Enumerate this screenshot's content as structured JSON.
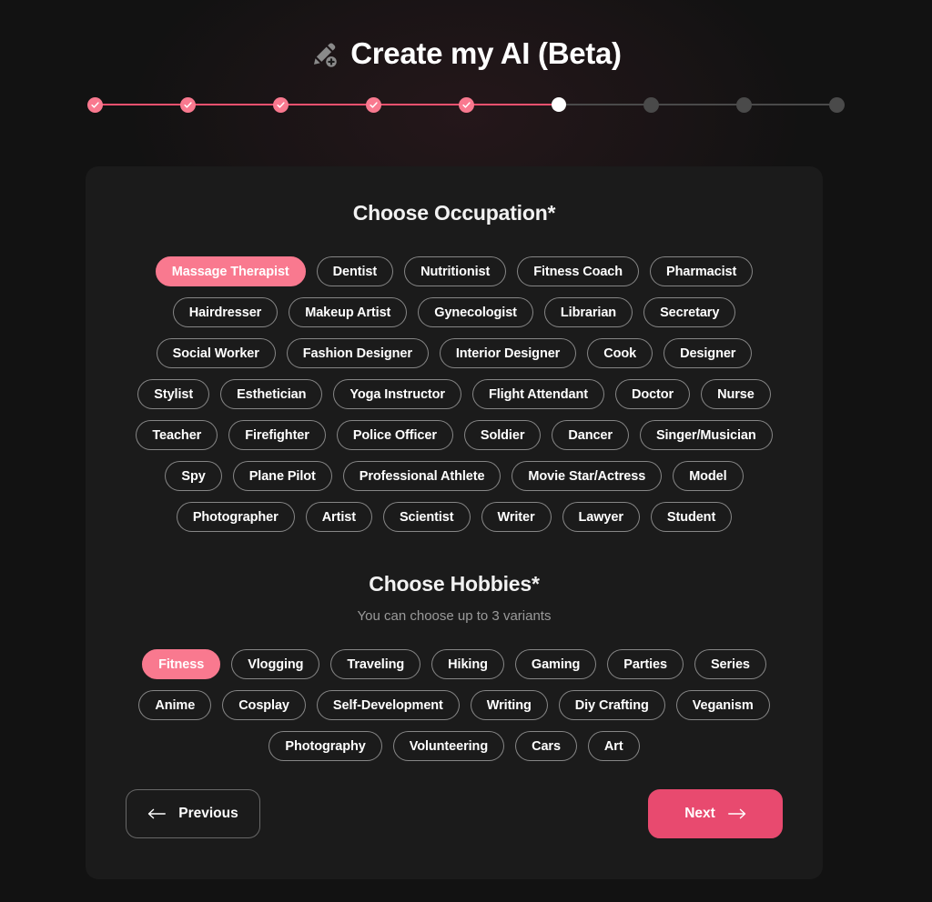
{
  "header": {
    "title": "Create my AI (Beta)",
    "icon": "pencil-plus-icon"
  },
  "stepper": {
    "total_steps": 9,
    "completed_steps": 5,
    "current_step": 6,
    "done_color": "#f9798f",
    "current_color": "#ffffff",
    "upcoming_color": "#4a4a4a",
    "steps": [
      {
        "state": "done"
      },
      {
        "state": "done"
      },
      {
        "state": "done"
      },
      {
        "state": "done"
      },
      {
        "state": "done"
      },
      {
        "state": "current"
      },
      {
        "state": "upcoming"
      },
      {
        "state": "upcoming"
      },
      {
        "state": "upcoming"
      }
    ]
  },
  "occupation": {
    "title": "Choose Occupation*",
    "selected": "Massage Therapist",
    "options": [
      {
        "label": "Massage Therapist",
        "selected": true
      },
      {
        "label": "Dentist",
        "selected": false
      },
      {
        "label": "Nutritionist",
        "selected": false
      },
      {
        "label": "Fitness Coach",
        "selected": false
      },
      {
        "label": "Pharmacist",
        "selected": false
      },
      {
        "label": "Hairdresser",
        "selected": false
      },
      {
        "label": "Makeup Artist",
        "selected": false
      },
      {
        "label": "Gynecologist",
        "selected": false
      },
      {
        "label": "Librarian",
        "selected": false
      },
      {
        "label": "Secretary",
        "selected": false
      },
      {
        "label": "Social Worker",
        "selected": false
      },
      {
        "label": "Fashion Designer",
        "selected": false
      },
      {
        "label": "Interior Designer",
        "selected": false
      },
      {
        "label": "Cook",
        "selected": false
      },
      {
        "label": "Designer",
        "selected": false
      },
      {
        "label": "Stylist",
        "selected": false
      },
      {
        "label": "Esthetician",
        "selected": false
      },
      {
        "label": "Yoga Instructor",
        "selected": false
      },
      {
        "label": "Flight Attendant",
        "selected": false
      },
      {
        "label": "Doctor",
        "selected": false
      },
      {
        "label": "Nurse",
        "selected": false
      },
      {
        "label": "Teacher",
        "selected": false
      },
      {
        "label": "Firefighter",
        "selected": false
      },
      {
        "label": "Police Officer",
        "selected": false
      },
      {
        "label": "Soldier",
        "selected": false
      },
      {
        "label": "Dancer",
        "selected": false
      },
      {
        "label": "Singer/Musician",
        "selected": false
      },
      {
        "label": "Spy",
        "selected": false
      },
      {
        "label": "Plane Pilot",
        "selected": false
      },
      {
        "label": "Professional Athlete",
        "selected": false
      },
      {
        "label": "Movie Star/Actress",
        "selected": false
      },
      {
        "label": "Model",
        "selected": false
      },
      {
        "label": "Photographer",
        "selected": false
      },
      {
        "label": "Artist",
        "selected": false
      },
      {
        "label": "Scientist",
        "selected": false
      },
      {
        "label": "Writer",
        "selected": false
      },
      {
        "label": "Lawyer",
        "selected": false
      },
      {
        "label": "Student",
        "selected": false
      }
    ]
  },
  "hobbies": {
    "title": "Choose Hobbies*",
    "subtitle": "You can choose up to 3 variants",
    "max_variants": 3,
    "selected": "Fitness",
    "options": [
      {
        "label": "Fitness",
        "selected": true
      },
      {
        "label": "Vlogging",
        "selected": false
      },
      {
        "label": "Traveling",
        "selected": false
      },
      {
        "label": "Hiking",
        "selected": false
      },
      {
        "label": "Gaming",
        "selected": false
      },
      {
        "label": "Parties",
        "selected": false
      },
      {
        "label": "Series",
        "selected": false
      },
      {
        "label": "Anime",
        "selected": false
      },
      {
        "label": "Cosplay",
        "selected": false
      },
      {
        "label": "Self-Development",
        "selected": false
      },
      {
        "label": "Writing",
        "selected": false
      },
      {
        "label": "Diy Crafting",
        "selected": false
      },
      {
        "label": "Veganism",
        "selected": false
      },
      {
        "label": "Photography",
        "selected": false
      },
      {
        "label": "Volunteering",
        "selected": false
      },
      {
        "label": "Cars",
        "selected": false
      },
      {
        "label": "Art",
        "selected": false
      }
    ]
  },
  "footer": {
    "previous_label": "Previous",
    "next_label": "Next",
    "previous_icon": "arrow-left-icon",
    "next_icon": "arrow-right-icon",
    "next_color": "#e84a6f"
  },
  "theme": {
    "page_background": "#121212",
    "card_background": "#1b1b1b",
    "accent_pink": "#f9798f",
    "accent_pink_strong": "#e84a6f"
  }
}
